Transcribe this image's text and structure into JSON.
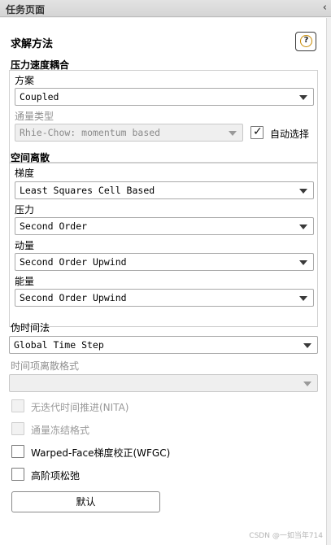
{
  "header": {
    "title": "任务页面",
    "collapse_glyph": "‹"
  },
  "section_title": "求解方法",
  "help_button": {
    "icon": "help-icon",
    "glyph": "?"
  },
  "pv_coupling": {
    "title": "压力速度耦合",
    "scheme_label": "方案",
    "scheme_value": "Coupled",
    "flux_type_label": "通量类型",
    "flux_type_value": "Rhie-Chow: momentum based",
    "auto_select_label": "自动选择",
    "auto_select_checked": true
  },
  "spatial": {
    "title": "空间离散",
    "gradient_label": "梯度",
    "gradient_value": "Least Squares Cell Based",
    "pressure_label": "压力",
    "pressure_value": "Second Order",
    "momentum_label": "动量",
    "momentum_value": "Second Order Upwind",
    "energy_label": "能量",
    "energy_value": "Second Order Upwind"
  },
  "pseudo_time": {
    "label": "伪时间法",
    "value": "Global Time Step"
  },
  "transient": {
    "label": "时间项离散格式",
    "value": ""
  },
  "options": [
    {
      "label": "无迭代时间推进(NITA)",
      "checked": false,
      "enabled": false
    },
    {
      "label": "通量冻结格式",
      "checked": false,
      "enabled": false
    },
    {
      "label": "Warped-Face梯度校正(WFGC)",
      "checked": false,
      "enabled": true
    },
    {
      "label": "高阶项松弛",
      "checked": false,
      "enabled": true
    }
  ],
  "default_button": "默认",
  "watermark": "CSDN @一如当年714"
}
